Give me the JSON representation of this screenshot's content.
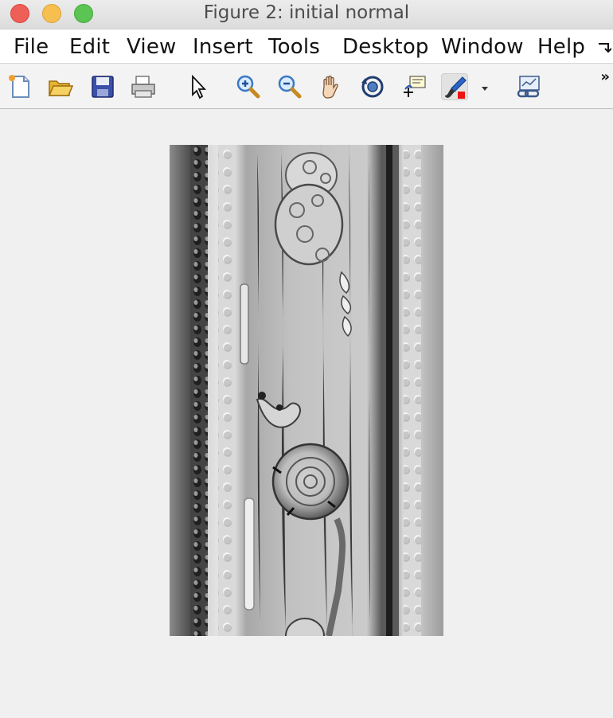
{
  "window": {
    "title": "Figure 2: initial normal"
  },
  "menubar": {
    "items": [
      "File",
      "Edit",
      "View",
      "Insert",
      "Tools",
      "Desktop",
      "Window",
      "Help"
    ]
  },
  "toolbar": {
    "tools": [
      {
        "icon": "new-figure-icon"
      },
      {
        "icon": "open-file-icon"
      },
      {
        "icon": "save-icon"
      },
      {
        "icon": "print-icon"
      },
      {
        "icon": "select-pointer-icon"
      },
      {
        "icon": "zoom-in-icon"
      },
      {
        "icon": "zoom-out-icon"
      },
      {
        "icon": "pan-hand-icon"
      },
      {
        "icon": "rotate-3d-icon"
      },
      {
        "icon": "data-cursor-icon"
      },
      {
        "icon": "brush-icon"
      },
      {
        "icon": "dropdown-arrow-icon"
      },
      {
        "icon": "link-plot-icon"
      }
    ],
    "overflow_symbol": "»"
  },
  "figure": {
    "image_description_color": "#a6a6a6"
  }
}
